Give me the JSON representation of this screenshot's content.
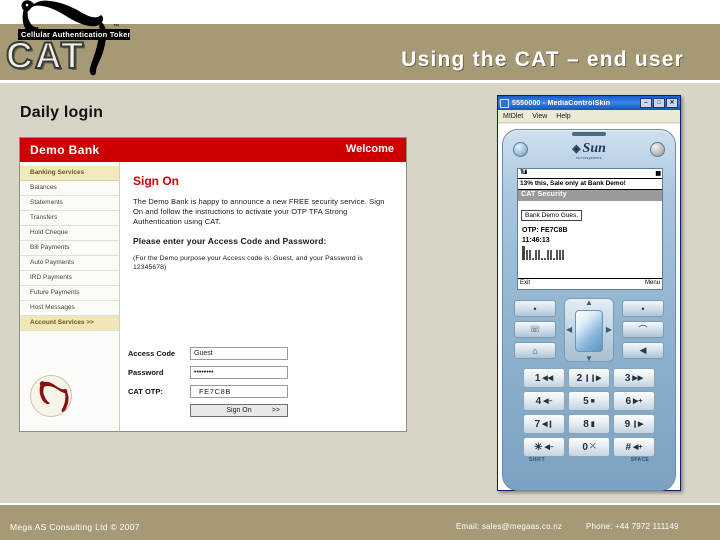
{
  "slide": {
    "title": "Using the CAT – end user",
    "caption": "Daily login",
    "accent_band": "#a59a75",
    "background": "#d8d4c6"
  },
  "logo": {
    "tagline": "Cellular Authentication Token",
    "wordmark": "CAT",
    "tm": "™",
    "icon": "panther-icon"
  },
  "bank": {
    "brand": "Demo Bank",
    "welcome": "Welcome",
    "brand_color": "#cc0000",
    "nav": [
      {
        "label": "Banking Services",
        "state": "active"
      },
      {
        "label": "Balances",
        "state": "normal"
      },
      {
        "label": "Statements",
        "state": "normal"
      },
      {
        "label": "Transfers",
        "state": "normal"
      },
      {
        "label": "Hold Cheque",
        "state": "normal"
      },
      {
        "label": "Bill Payments",
        "state": "normal"
      },
      {
        "label": "Auto Payments",
        "state": "normal"
      },
      {
        "label": "IRD Payments",
        "state": "normal"
      },
      {
        "label": "Future Payments",
        "state": "normal"
      },
      {
        "label": "Host Messages",
        "state": "normal"
      },
      {
        "label": "Account Services  >>",
        "state": "bottom"
      }
    ],
    "signon_heading": "Sign On",
    "intro": "The Demo Bank is happy to announce a new FREE security service. Sign On and follow the instructions to activate your OTP TFA Strong Authentication using CAT.",
    "prompt": "Please enter your Access Code and Password:",
    "note": "(For the Demo purpose your Access code is: Guest, and your Password is 12345678)",
    "form": {
      "access_code_label": "Access Code",
      "access_code_value": "Guest",
      "password_label": "Password",
      "password_value": "••••••••",
      "otp_label": "CAT OTP:",
      "otp_value": "FE7C8B",
      "submit_label": "Sign On",
      "submit_arrows": ">>"
    }
  },
  "emulator": {
    "window_title": "5550000 - MediaControlSkin",
    "title_buttons": [
      "–",
      "□",
      "✕"
    ],
    "menu": [
      "MIDlet",
      "View",
      "Help"
    ],
    "phone": {
      "vendor": "Sun",
      "vendor_sub": "microsystems",
      "screen": {
        "signal": "Tull",
        "battery": "▮▮",
        "ticker": "13% this, Sale only at Bank Demo!",
        "header": "CAT Security",
        "account": "Bank Demo Gues.",
        "otp_line": "OTP: FE7C8B",
        "counter": "11:46:13",
        "softkey_left": "Exit",
        "softkey_right": "Menu"
      },
      "side_buttons_left": [
        "•",
        "☏",
        "⌂"
      ],
      "side_buttons_right": [
        "•",
        "⌒",
        "◀"
      ],
      "keys": [
        {
          "digit": "1",
          "sub": "◀◀"
        },
        {
          "digit": "2",
          "sub": "❙❙▶"
        },
        {
          "digit": "3",
          "sub": "▶▶"
        },
        {
          "digit": "4",
          "sub": "◀–"
        },
        {
          "digit": "5",
          "sub": "■"
        },
        {
          "digit": "6",
          "sub": "▶+"
        },
        {
          "digit": "7",
          "sub": "◀❙"
        },
        {
          "digit": "8",
          "sub": "▮"
        },
        {
          "digit": "9",
          "sub": "❙▶"
        },
        {
          "digit": "✳",
          "sub": "◀–"
        },
        {
          "digit": "0",
          "sub": "⤫"
        },
        {
          "digit": "#",
          "sub": "◀+"
        }
      ],
      "softkey_labels": {
        "left": "SHIFT",
        "right": "SPACE"
      }
    }
  },
  "footer": {
    "company": "Mega AS Consulting Ltd  ©  2007",
    "email": "Email: sales@megaas.co.nz",
    "phone": "Phone: +44 7972 111149"
  }
}
